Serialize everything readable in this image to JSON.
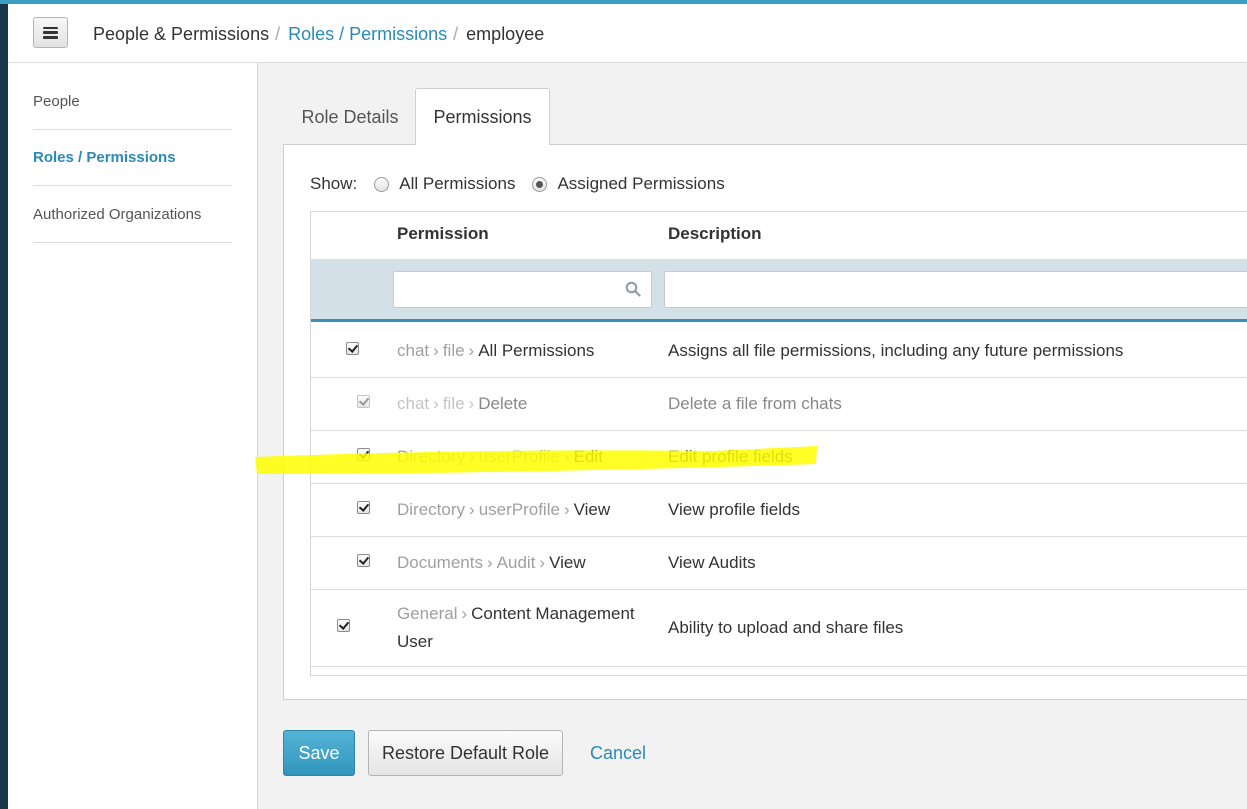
{
  "header": {
    "menu_icon": "hamburger-menu-icon",
    "breadcrumb": [
      "People & Permissions",
      "Roles / Permissions",
      "employee"
    ]
  },
  "sidebar": {
    "items": [
      {
        "label": "People",
        "active": false
      },
      {
        "label": "Roles / Permissions",
        "active": true
      },
      {
        "label": "Authorized Organizations",
        "active": false
      }
    ]
  },
  "tabs": [
    {
      "label": "Role Details",
      "active": false
    },
    {
      "label": "Permissions",
      "active": true
    }
  ],
  "show": {
    "label": "Show:",
    "options": [
      {
        "label": "All Permissions",
        "checked": false
      },
      {
        "label": "Assigned Permissions",
        "checked": true
      }
    ]
  },
  "table": {
    "headers": {
      "permission": "Permission",
      "description": "Description"
    },
    "filters": {
      "permission_value": "",
      "description_value": ""
    },
    "rows": [
      {
        "checked": true,
        "disabled": false,
        "path": [
          "chat",
          "file"
        ],
        "leaf": "All Permissions",
        "description": "Assigns all file permissions, including any future permissions"
      },
      {
        "checked": true,
        "disabled": true,
        "path": [
          "chat",
          "file"
        ],
        "leaf": "Delete",
        "description": "Delete a file from chats"
      },
      {
        "checked": true,
        "disabled": false,
        "path": [
          "Directory",
          "userProfile"
        ],
        "leaf": "Edit",
        "description": "Edit profile fields",
        "highlighted": true
      },
      {
        "checked": true,
        "disabled": false,
        "path": [
          "Directory",
          "userProfile"
        ],
        "leaf": "View",
        "description": "View profile fields"
      },
      {
        "checked": true,
        "disabled": false,
        "path": [
          "Documents",
          "Audit"
        ],
        "leaf": "View",
        "description": "View Audits"
      },
      {
        "checked": true,
        "disabled": false,
        "path": [
          "General"
        ],
        "leaf": "Content Management User",
        "description": "Ability to upload and share files"
      }
    ],
    "highlight_color": "#ffff00"
  },
  "actions": {
    "save_label": "Save",
    "restore_label": "Restore Default Role",
    "cancel_label": "Cancel"
  },
  "colors": {
    "accent": "#3aa0c2",
    "link": "#2a8ab7",
    "primary_button": "#3196bd"
  }
}
